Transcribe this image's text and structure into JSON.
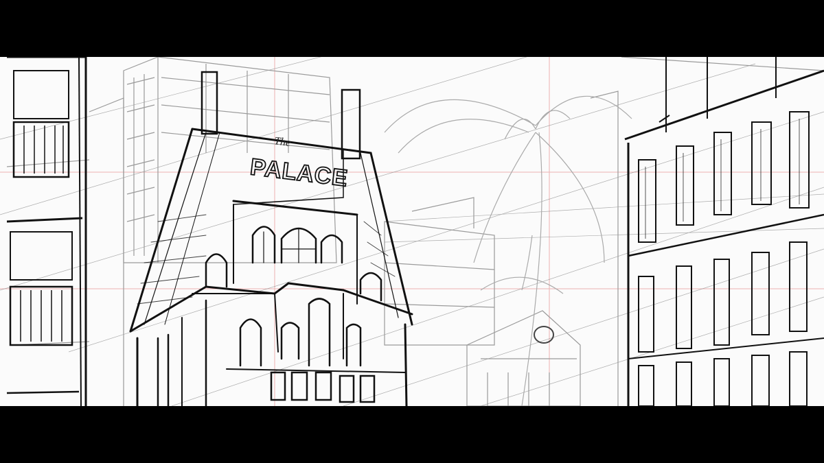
{
  "scene": {
    "sign_title": "PALACE",
    "sign_subtitle": "The",
    "guide_color": "#e8a0a0",
    "ink_dark": "#111111",
    "ink_light": "#9a9a9a",
    "letterbox_color": "#000000"
  }
}
